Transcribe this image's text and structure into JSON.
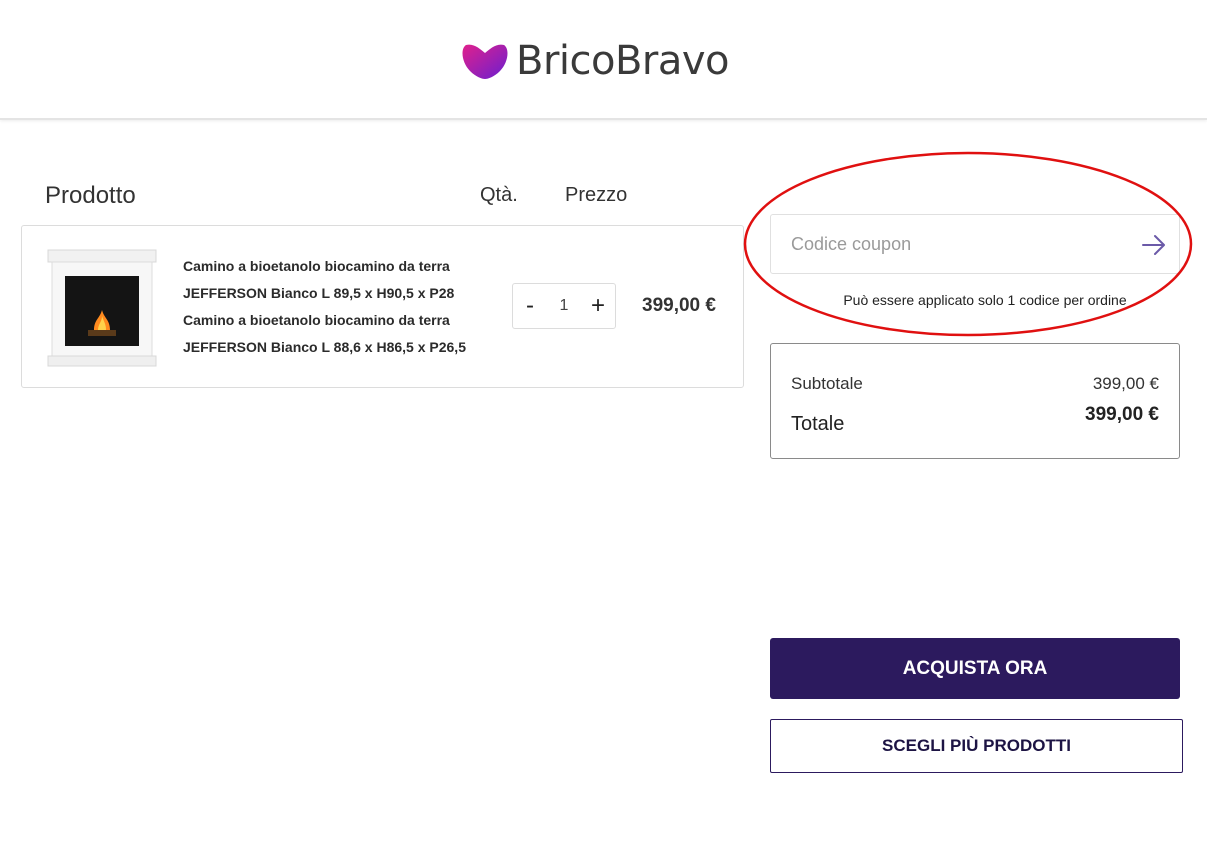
{
  "header": {
    "logo_text": "BricoBravo"
  },
  "columns": {
    "product": "Prodotto",
    "qty": "Qtà.",
    "price": "Prezzo"
  },
  "cart": {
    "items": [
      {
        "name_line1": "Camino a bioetanolo biocamino da terra",
        "name_line2": "JEFFERSON Bianco L 89,5 x H90,5 x P28",
        "name_line3": "Camino a bioetanolo biocamino da terra",
        "name_line4": "JEFFERSON Bianco L 88,6 x H86,5 x P26,5",
        "qty_minus": "-",
        "qty": "1",
        "qty_plus": "+",
        "price": "399,00 €",
        "image_icon": "fireplace-product-image"
      }
    ]
  },
  "coupon": {
    "placeholder": "Codice coupon",
    "value": "",
    "submit_icon": "arrow-right-icon",
    "note": "Può essere applicato solo 1 codice per ordine"
  },
  "totals": {
    "subtotal_label": "Subtotale",
    "subtotal_value": "399,00 €",
    "total_label": "Totale",
    "total_value": "399,00 €"
  },
  "actions": {
    "buy_label": "ACQUISTA ORA",
    "more_label": "SCEGLI PIÙ PRODOTTI"
  },
  "colors": {
    "brand_primary": "#2c1a5e",
    "logo_gradient_start": "#e0208c",
    "logo_gradient_end": "#6a1fd0",
    "annotation": "#e01010"
  }
}
